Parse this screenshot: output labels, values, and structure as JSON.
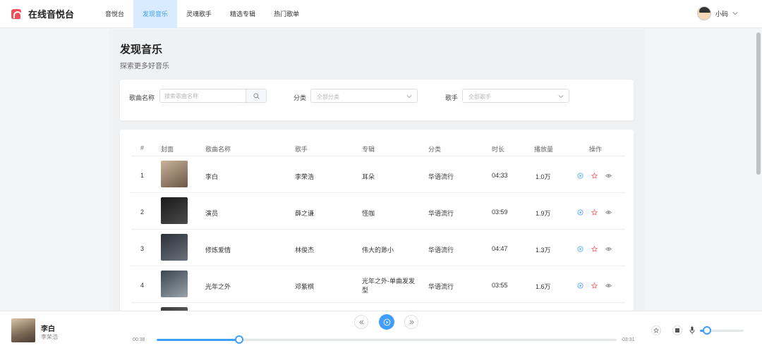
{
  "app": {
    "title": "在线音悦台"
  },
  "nav": {
    "items": [
      {
        "label": "音悦台",
        "active": false
      },
      {
        "label": "发现音乐",
        "active": true
      },
      {
        "label": "灵魂歌手",
        "active": false
      },
      {
        "label": "精选专辑",
        "active": false
      },
      {
        "label": "热门歌单",
        "active": false
      }
    ]
  },
  "user": {
    "name": "小码"
  },
  "page": {
    "title": "发现音乐",
    "subtitle": "探索更多好音乐"
  },
  "filters": {
    "song_label": "歌曲名称",
    "song_placeholder": "搜索歌曲名称",
    "category_label": "分类",
    "category_value": "全部分类",
    "singer_label": "歌手",
    "singer_value": "全部歌手"
  },
  "table": {
    "columns": [
      "#",
      "封面",
      "歌曲名称",
      "歌手",
      "专辑",
      "分类",
      "时长",
      "播放量",
      "操作"
    ],
    "rows": [
      {
        "index": "1",
        "song": "李白",
        "singer": "李荣浩",
        "album": "耳朵",
        "category": "华语流行",
        "duration": "04:33",
        "plays": "1.0万",
        "cover": [
          "#c9b39a",
          "#6b5646"
        ]
      },
      {
        "index": "2",
        "song": "演员",
        "singer": "薛之谦",
        "album": "怪咖",
        "category": "华语流行",
        "duration": "03:59",
        "plays": "1.9万",
        "cover": [
          "#1a1a1a",
          "#4a4a4a"
        ]
      },
      {
        "index": "3",
        "song": "修炼爱情",
        "singer": "林俊杰",
        "album": "伟大的渺小",
        "category": "华语流行",
        "duration": "04:47",
        "plays": "1.3万",
        "cover": [
          "#2b3038",
          "#6a717a"
        ]
      },
      {
        "index": "4",
        "song": "光年之外",
        "singer": "邓紫棋",
        "album": "光年之外-单曲发发型",
        "category": "华语流行",
        "duration": "03:55",
        "plays": "1.6万",
        "cover": [
          "#3a4550",
          "#9aa3ab"
        ]
      }
    ],
    "op_icons": [
      "play-circle-icon",
      "star-icon",
      "eye-icon"
    ]
  },
  "player": {
    "title": "李白",
    "artist": "李荣浩",
    "current_time": "00:38",
    "total_time": "03:31",
    "progress": 0.18,
    "volume": 0.16
  },
  "colors": {
    "accent": "#409eff",
    "nav_active_bg": "#d8ebff",
    "logo": "#f0505a",
    "star": "#f56c6c"
  }
}
